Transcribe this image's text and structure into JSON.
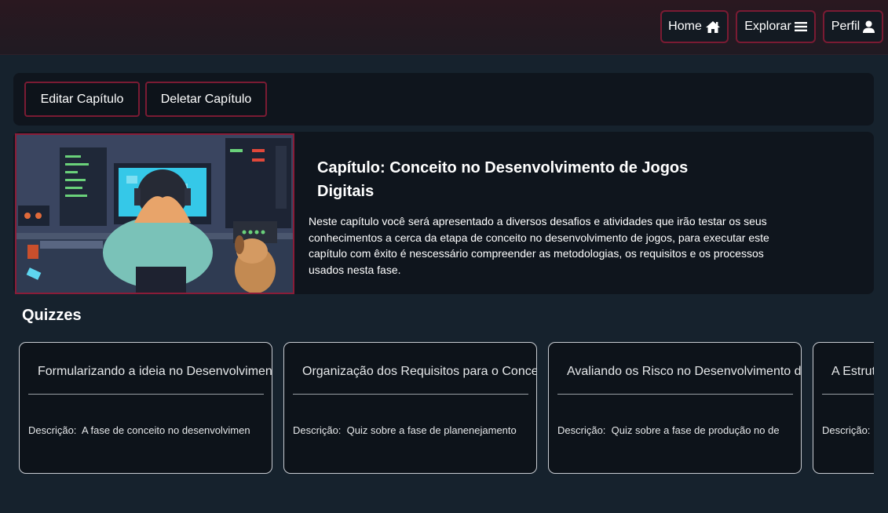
{
  "nav": {
    "home_label": "Home",
    "explore_label": "Explorar",
    "profile_label": "Perfil"
  },
  "actions": {
    "edit_label": "Editar Capítulo",
    "delete_label": "Deletar Capítulo"
  },
  "chapter": {
    "title": "Capítulo: Conceito no Desenvolvimento de Jogos Digitais",
    "description": "Neste capítulo você será apresentado a diversos desafios e atividades que irão testar os seus conhecimentos a cerca da etapa de conceito no desenvolvimento de jogos, para executar este capítulo com êxito é nescessário compreender as metodologias, os requisitos e os processos usados nesta fase."
  },
  "quizzes_section": {
    "title": "Quizzes",
    "desc_prefix": "Descrição:",
    "items": [
      {
        "title": "Formularizando a ideia no Desenvolvimen",
        "description": "A fase de conceito no desenvolvimen"
      },
      {
        "title": "Organização dos Requisitos para o Conce",
        "description": "Quiz sobre a fase de planenejamento"
      },
      {
        "title": "Avaliando os Risco no Desenvolvimento d",
        "description": "Quiz sobre a fase de produção no de"
      },
      {
        "title": "A Estrut",
        "description": ""
      }
    ]
  },
  "colors": {
    "accent_border": "#7a1b33",
    "page_bg": "#16222d",
    "panel_bg": "#0f151d"
  },
  "icons": {
    "home": "home-icon",
    "explore": "menu-icon",
    "profile": "user-icon"
  }
}
